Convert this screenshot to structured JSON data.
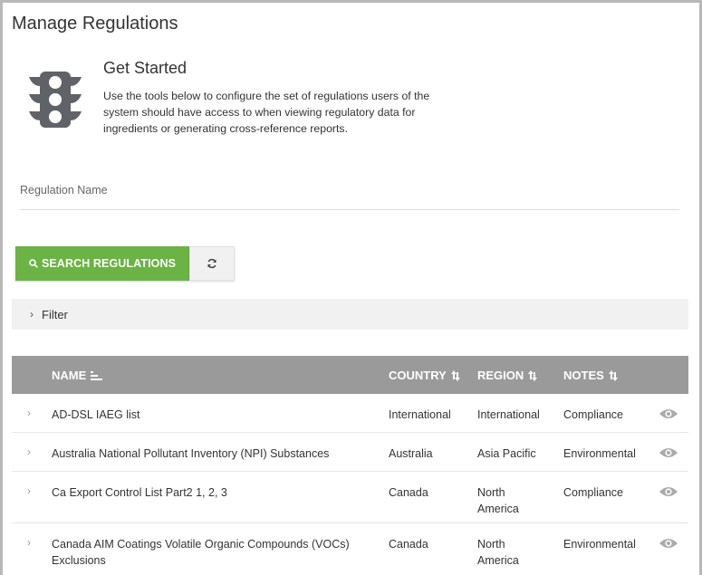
{
  "page": {
    "title": "Manage Regulations"
  },
  "intro": {
    "icon": "traffic-light-icon",
    "heading": "Get Started",
    "text": "Use the tools below to configure the set of regulations users of the system should have access to when viewing regulatory data for ingredients or generating cross-reference reports."
  },
  "form": {
    "regulation_name_label": "Regulation Name",
    "regulation_name_value": ""
  },
  "buttons": {
    "search_label": "SEARCH REGULATIONS",
    "search_icon": "search-icon",
    "reset_icon": "refresh-icon",
    "search_color": "#6ab344"
  },
  "filter": {
    "label": "Filter"
  },
  "table": {
    "header_color": "#9a9a9a",
    "columns": {
      "name": "NAME",
      "country": "COUNTRY",
      "region": "REGION",
      "notes": "NOTES"
    },
    "rows": [
      {
        "name": "AD-DSL IAEG list",
        "country": "International",
        "region": "International",
        "region2": "",
        "notes": "Compliance"
      },
      {
        "name": "Australia National Pollutant Inventory (NPI) Substances",
        "country": "Australia",
        "region": "Asia Pacific",
        "region2": "",
        "notes": "Environmental"
      },
      {
        "name": "Ca Export Control List Part2 1, 2, 3",
        "country": "Canada",
        "region": "North",
        "region2": "America",
        "notes": "Compliance"
      },
      {
        "name": "Canada AIM Coatings Volatile Organic Compounds (VOCs)",
        "name2": "Exclusions",
        "country": "Canada",
        "region": "North",
        "region2": "America",
        "notes": "Environmental"
      }
    ]
  }
}
